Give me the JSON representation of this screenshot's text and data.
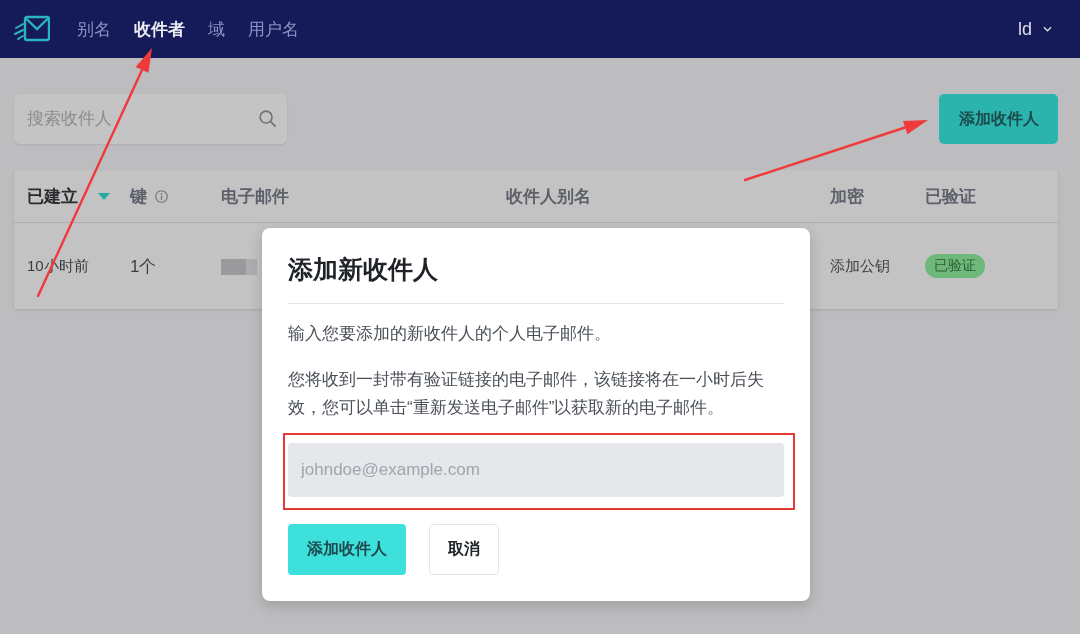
{
  "navbar": {
    "items": [
      {
        "label": "别名",
        "selected": false
      },
      {
        "label": "收件者",
        "selected": true
      },
      {
        "label": "域",
        "selected": false
      },
      {
        "label": "用户名",
        "selected": false
      }
    ],
    "user": "ld"
  },
  "search": {
    "placeholder": "搜索收件人"
  },
  "add_button": {
    "label": "添加收件人"
  },
  "table": {
    "columns": [
      {
        "label": "已建立",
        "sorted": true,
        "info": false
      },
      {
        "label": "键",
        "sorted": false,
        "info": true
      },
      {
        "label": "电子邮件",
        "sorted": false,
        "info": false
      },
      {
        "label": "收件人别名",
        "sorted": false,
        "info": false
      },
      {
        "label": "加密",
        "sorted": false,
        "info": false
      },
      {
        "label": "已验证",
        "sorted": false,
        "info": false
      }
    ],
    "rows": [
      {
        "created": "10小时前",
        "keys": "1个",
        "email_redacted": true,
        "encryption": "添加公钥",
        "verified": "已验证"
      }
    ]
  },
  "dialog": {
    "title": "添加新收件人",
    "paragraphs": [
      "输入您要添加的新收件人的个人电子邮件。",
      "您将收到一封带有验证链接的电子邮件，该链接将在一小时后失效，您可以单击“重新发送电子邮件”以获取新的电子邮件。"
    ],
    "email_field": {
      "placeholder": "johndoe@example.com"
    },
    "buttons": [
      {
        "label": "添加收件人",
        "kind": "primary"
      },
      {
        "label": "取消",
        "kind": "secondary"
      }
    ]
  }
}
